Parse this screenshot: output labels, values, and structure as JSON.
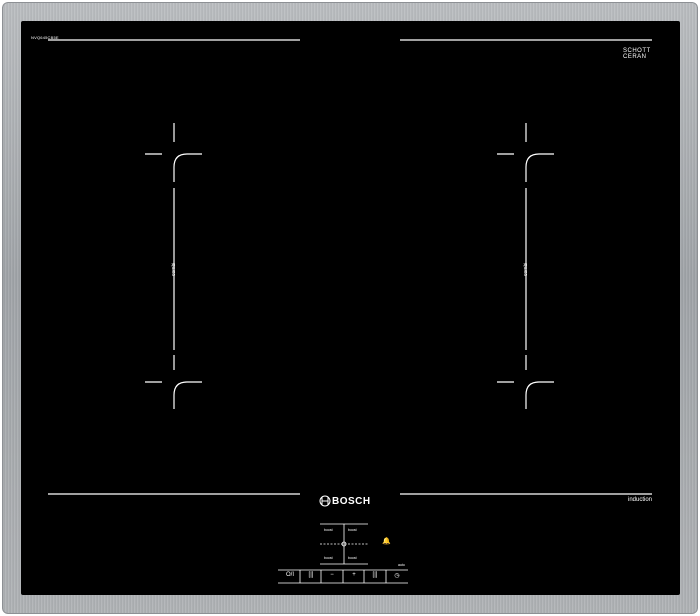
{
  "hob": {
    "model": "NVQ645CB5E",
    "glass_brand_line1": "SCHOTT",
    "glass_brand_line2": "CERAN",
    "glass_sub": "",
    "brand": "BOSCH",
    "type_label": "induction",
    "zones": [
      {
        "label": "combi"
      },
      {
        "label": "combi"
      }
    ],
    "boost": [
      "boost",
      "boost",
      "boost",
      "boost"
    ],
    "controls": [
      {
        "name": "power-icon",
        "glyph": "O/I"
      },
      {
        "name": "select-icon",
        "glyph": "[|]"
      },
      {
        "name": "minus-icon",
        "glyph": "−"
      },
      {
        "name": "plus-icon",
        "glyph": "+"
      },
      {
        "name": "select2-icon",
        "glyph": "[|]"
      },
      {
        "name": "timer-icon",
        "glyph": "◷"
      }
    ],
    "bell": "🔔",
    "auto_label": "auto"
  }
}
